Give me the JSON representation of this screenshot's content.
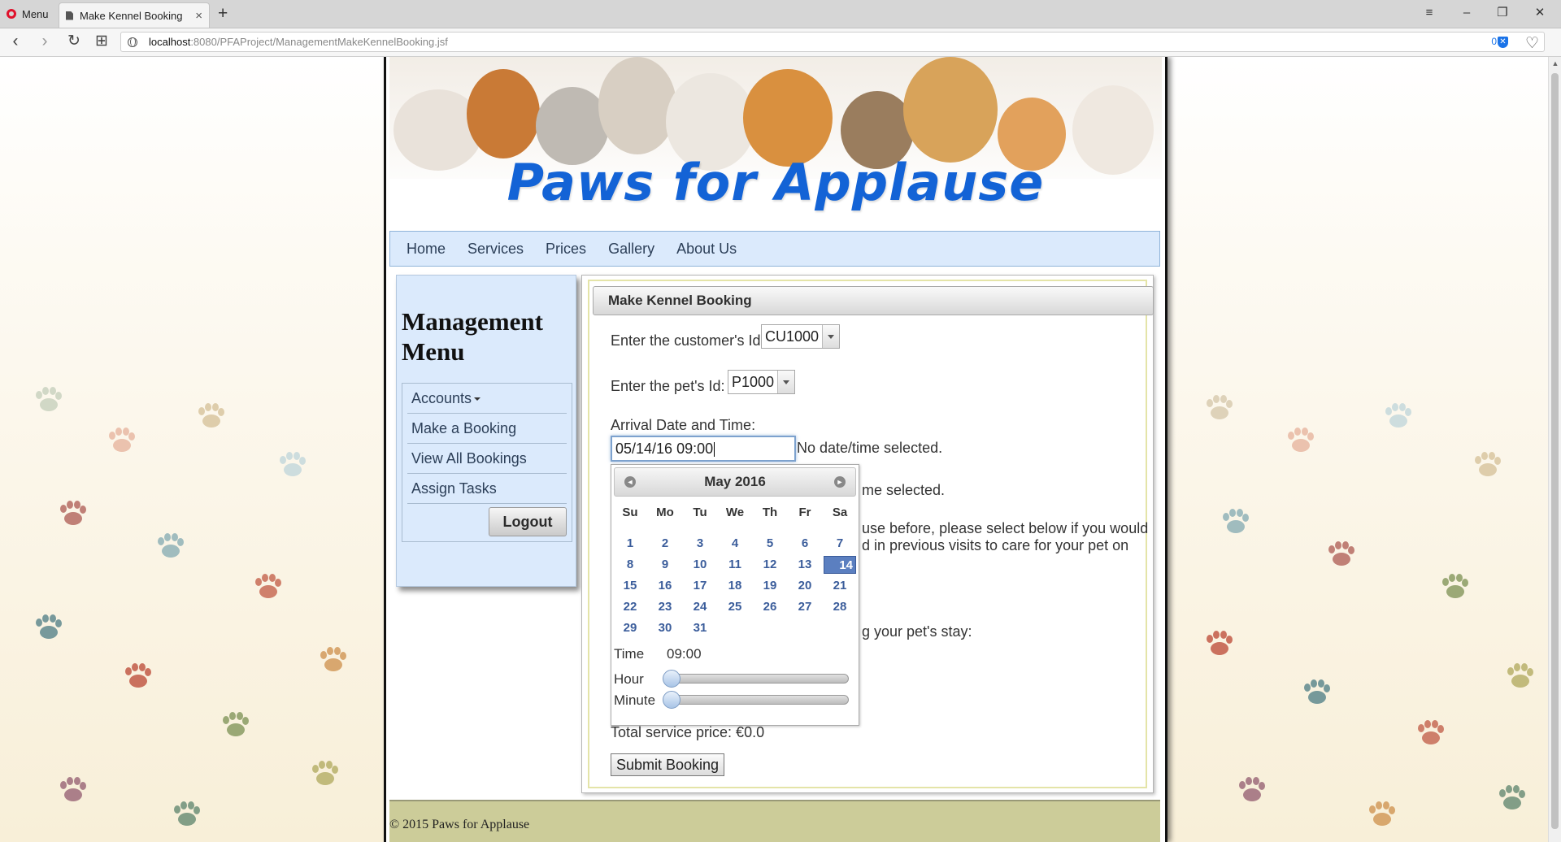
{
  "browser": {
    "menu_label": "Menu",
    "tab_title": "Make Kennel Booking",
    "tab_close": "×",
    "new_tab": "+",
    "url_host": "localhost",
    "url_path": ":8080/PFAProject/ManagementMakeKennelBooking.jsf",
    "badge_count": "0",
    "window_controls": {
      "sidebar": "≡",
      "minimize": "–",
      "maximize": "❐",
      "close": "✕"
    },
    "nav": {
      "back": "‹",
      "forward": "›",
      "reload": "↻",
      "speed_dial": "⊞",
      "favorite": "♡"
    }
  },
  "site": {
    "brand": "Paws for Applause",
    "nav": [
      "Home",
      "Services",
      "Prices",
      "Gallery",
      "About Us"
    ],
    "footer": "© 2015 Paws for Applause"
  },
  "management_menu": {
    "title": "Management Menu",
    "items": [
      "Accounts",
      "Make a Booking",
      "View All Bookings",
      "Assign Tasks"
    ],
    "logout": "Logout"
  },
  "booking_form": {
    "header": "Make Kennel Booking",
    "customer_label": "Enter the customer's Id:",
    "customer_value": "CU1000",
    "pet_label": "Enter the pet's Id:",
    "pet_value": "P1000",
    "arrival_label": "Arrival Date and Time:",
    "arrival_value": "05/14/16 09:00",
    "arrival_status": "No date/time selected.",
    "departure_status_partial": "me selected.",
    "history_partial_1": "use before, please select below if you would",
    "history_partial_2": "d in previous visits to care for your pet on",
    "stay_partial": "g your pet's stay:",
    "total_price": "Total service price: €0.0",
    "submit": "Submit Booking"
  },
  "datepicker": {
    "month_label": "May 2016",
    "prev": "◄",
    "next": "►",
    "weekdays": [
      "Su",
      "Mo",
      "Tu",
      "We",
      "Th",
      "Fr",
      "Sa"
    ],
    "days": [
      "1",
      "2",
      "3",
      "4",
      "5",
      "6",
      "7",
      "8",
      "9",
      "10",
      "11",
      "12",
      "13",
      "14",
      "15",
      "16",
      "17",
      "18",
      "19",
      "20",
      "21",
      "22",
      "23",
      "24",
      "25",
      "26",
      "27",
      "28",
      "29",
      "30",
      "31"
    ],
    "selected_day": "14",
    "time_label": "Time",
    "time_value": "09:00",
    "hour_label": "Hour",
    "minute_label": "Minute",
    "hour_level": 0,
    "minute_level": 0
  },
  "colors": {
    "accent_blue": "#1363d6",
    "nav_bg": "#dbeafc",
    "footer_bg": "#cccc99",
    "selected_day_bg": "#5b7fc0"
  },
  "icons": [
    "opera-logo-icon",
    "page-icon",
    "globe-icon",
    "shield-icon",
    "heart-icon",
    "caret-down-icon"
  ]
}
